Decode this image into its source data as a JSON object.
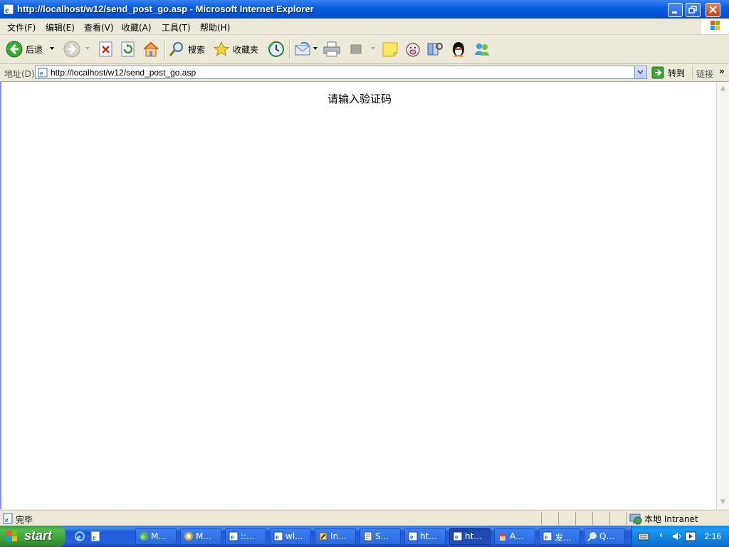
{
  "window": {
    "title": "http://localhost/w12/send_post_go.asp - Microsoft Internet Explorer"
  },
  "menu": [
    {
      "label": "文件(F)"
    },
    {
      "label": "编辑(E)"
    },
    {
      "label": "查看(V)"
    },
    {
      "label": "收藏(A)"
    },
    {
      "label": "工具(T)"
    },
    {
      "label": "帮助(H)"
    }
  ],
  "toolbar": {
    "back_label": "后退",
    "search_label": "搜索",
    "favorites_label": "收藏夹"
  },
  "address": {
    "label": "地址(D)",
    "url": "http://localhost/w12/send_post_go.asp",
    "go_label": "转到",
    "links_label": "链接"
  },
  "page": {
    "message": "请输入验证码"
  },
  "status": {
    "text": "完毕",
    "zone": "本地 Intranet"
  },
  "taskbar": {
    "start_label": "start",
    "tasks": [
      {
        "label": "M...",
        "icon": "browser-icon"
      },
      {
        "label": "M...",
        "icon": "app-icon"
      },
      {
        "label": "::...",
        "icon": "ie-icon"
      },
      {
        "label": "wl...",
        "icon": "ie-icon"
      },
      {
        "label": "In...",
        "icon": "tool-icon"
      },
      {
        "label": "S...",
        "icon": "page-icon"
      },
      {
        "label": "ht...",
        "icon": "ie-icon"
      },
      {
        "label": "ht...",
        "icon": "ie-icon",
        "active": true
      },
      {
        "label": "A...",
        "icon": "house-icon"
      },
      {
        "label": "发...",
        "icon": "ie-icon"
      },
      {
        "label": "Q...",
        "icon": "search-icon"
      }
    ],
    "clock": "2:16"
  }
}
